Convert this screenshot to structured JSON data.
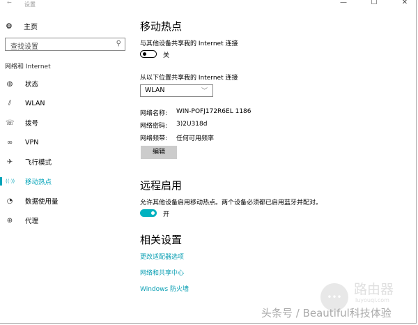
{
  "window": {
    "title": "设置",
    "minimize": "—",
    "maximize": "☐",
    "close": "✕",
    "back": "←"
  },
  "sidebar": {
    "home": "主页",
    "search_placeholder": "查找设置",
    "section": "网络和 Internet",
    "items": [
      {
        "label": "状态",
        "icon": "◍"
      },
      {
        "label": "WLAN",
        "icon": "⫽"
      },
      {
        "label": "拨号",
        "icon": "☏"
      },
      {
        "label": "VPN",
        "icon": "∞"
      },
      {
        "label": "飞行模式",
        "icon": "✈"
      },
      {
        "label": "移动热点",
        "icon": "((·))"
      },
      {
        "label": "数据使用量",
        "icon": "◔"
      },
      {
        "label": "代理",
        "icon": "⊕"
      }
    ],
    "active": "移动热点"
  },
  "main": {
    "title": "移动热点",
    "share_label": "与其他设备共享我的 Internet 连接",
    "share_state": "关",
    "from_label": "从以下位置共享我的 Internet 连接",
    "from_value": "WLAN",
    "name_label": "网络名称:",
    "name_value": "WIN-POFJ172R6EL 1186",
    "pwd_label": "网络密码:",
    "pwd_value": "3)2U318d",
    "band_label": "网络频带:",
    "band_value": "任何可用频率",
    "edit": "编辑",
    "remote_title": "远程启用",
    "remote_desc": "允许其他设备启用移动热点。两个设备必须都已启用蓝牙并配对。",
    "remote_state": "开",
    "related_title": "相关设置",
    "links": [
      "更改适配器选项",
      "网络和共享中心",
      "Windows 防火墙"
    ]
  },
  "watermark": {
    "text": "头条号 / Beautiful科技体验",
    "logo": "路由器",
    "logo_url": "luyouqi.com"
  },
  "colors": {
    "accent": "#00a3b8"
  }
}
